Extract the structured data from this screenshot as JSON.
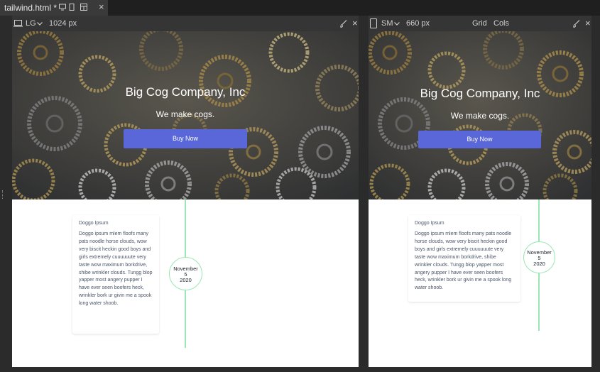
{
  "tab": {
    "title": "tailwind.html *",
    "close": "×"
  },
  "panels": [
    {
      "device": "LG",
      "width_label": "1024 px",
      "close": "×"
    },
    {
      "device": "SM",
      "width_label": "660 px",
      "grid_label": "Grid",
      "cols_label": "Cols",
      "close": "×"
    }
  ],
  "page": {
    "hero": {
      "title": "Big Cog Company, Inc",
      "subtitle": "We make cogs.",
      "button": "Buy Now"
    },
    "card": {
      "title": "Doggo Ipsum",
      "body_lg": "Doggo ipsum mlem floofs many pats noodle horse clouds, wow very biscit heckin good boys and girls extremely cuuuuuute very taste wow maximum borkdrive, shibe wrinkler clouds. Tungg blop yapper most angery pupper I have ever seen boofers heck, wrinkler bork ur givin me a spook long water shoob.",
      "body_sm": "Doggo ipsum mlem floofs many pats noodle horse clouds, wow very biscit heckin good boys and girls extremely cuuuuuute very taste wow maximum borkdrive, shibe wrinkler clouds. Tungg blop yapper most angery pupper I have ever seen boofers heck, wrinkler bork ur givin me a spook long water shoob."
    },
    "date": {
      "month": "November",
      "day": "5",
      "year": "2020"
    }
  },
  "colors": {
    "button": "#5a67d8",
    "timeline": "#9ae6b4"
  }
}
